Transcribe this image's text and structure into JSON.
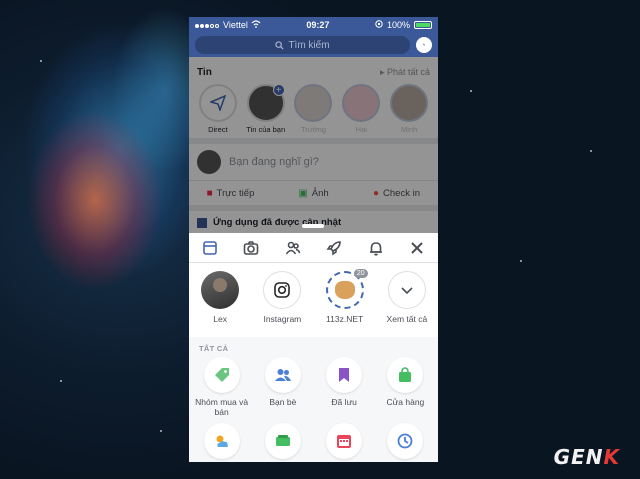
{
  "status_bar": {
    "carrier": "Viettel",
    "time": "09:27",
    "battery": "100%",
    "signal_bars_filled": 3
  },
  "header": {
    "search_placeholder": "Tìm kiếm",
    "search_icon": "search-icon",
    "messenger_icon": "messenger-icon"
  },
  "feed": {
    "stories_title": "Tin",
    "stories_link": "▸ Phát tất cả",
    "stories": [
      {
        "label": "Direct"
      },
      {
        "label": "Tin của bạn"
      },
      {
        "label": "Trường"
      },
      {
        "label": "Hai"
      },
      {
        "label": "Minh"
      }
    ],
    "compose_placeholder": "Bạn đang nghĩ gì?",
    "actions": [
      {
        "label": "Trực tiếp",
        "icon": "live-video-icon",
        "color": "#f02849"
      },
      {
        "label": "Ảnh",
        "icon": "photo-icon",
        "color": "#45bd62"
      },
      {
        "label": "Check in",
        "icon": "location-pin-icon",
        "color": "#f5533d"
      }
    ],
    "notification_text": "Ứng dụng đã được cập nhật"
  },
  "sheet": {
    "tabs": [
      "shortcuts-icon",
      "camera-icon",
      "friends-icon",
      "rocket-icon",
      "bell-icon",
      "close-icon"
    ],
    "recent": [
      {
        "label": "Lex"
      },
      {
        "label": "Instagram"
      },
      {
        "label": "113z.NET",
        "badge": "20"
      },
      {
        "label": "Xem tất cả"
      }
    ],
    "section_title": "TẤT CẢ",
    "shortcuts_row1": [
      {
        "label": "Nhóm mua và bán",
        "icon": "tag-icon",
        "color": "#6bc581"
      },
      {
        "label": "Bạn bè",
        "icon": "friends-icon",
        "color": "#4a7fd6"
      },
      {
        "label": "Đã lưu",
        "icon": "bookmark-icon",
        "color": "#8a54c7"
      },
      {
        "label": "Cửa hàng",
        "icon": "shopping-bag-icon",
        "color": "#45bd62"
      }
    ],
    "shortcuts_row2": [
      {
        "icon": "weather-icon",
        "color": "#f5a623"
      },
      {
        "icon": "payments-icon",
        "color": "#45bd62"
      },
      {
        "icon": "calendar-icon",
        "color": "#e9455a"
      },
      {
        "icon": "history-icon",
        "color": "#4a7fd6"
      }
    ]
  },
  "watermark": {
    "text_main": "GEN",
    "text_accent": "K"
  }
}
